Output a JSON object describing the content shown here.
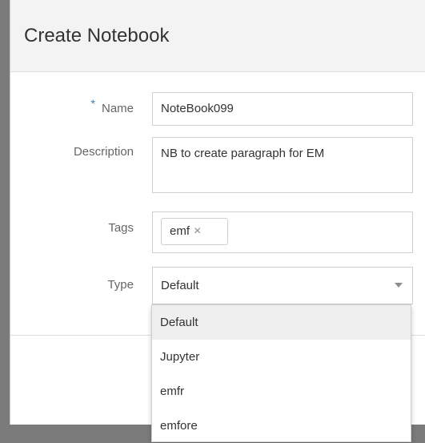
{
  "dialog": {
    "title": "Create Notebook"
  },
  "form": {
    "name": {
      "label": "Name",
      "required_marker": "*",
      "value": "NoteBook099"
    },
    "description": {
      "label": "Description",
      "value": "NB to create paragraph for EM"
    },
    "tags": {
      "label": "Tags",
      "chips": [
        {
          "label": "emf",
          "remove_icon": "×"
        }
      ]
    },
    "type": {
      "label": "Type",
      "value": "Default"
    }
  },
  "type_dropdown": {
    "options": [
      "Default",
      "Jupyter",
      "emfr",
      "emfore"
    ],
    "selected": "Default"
  }
}
